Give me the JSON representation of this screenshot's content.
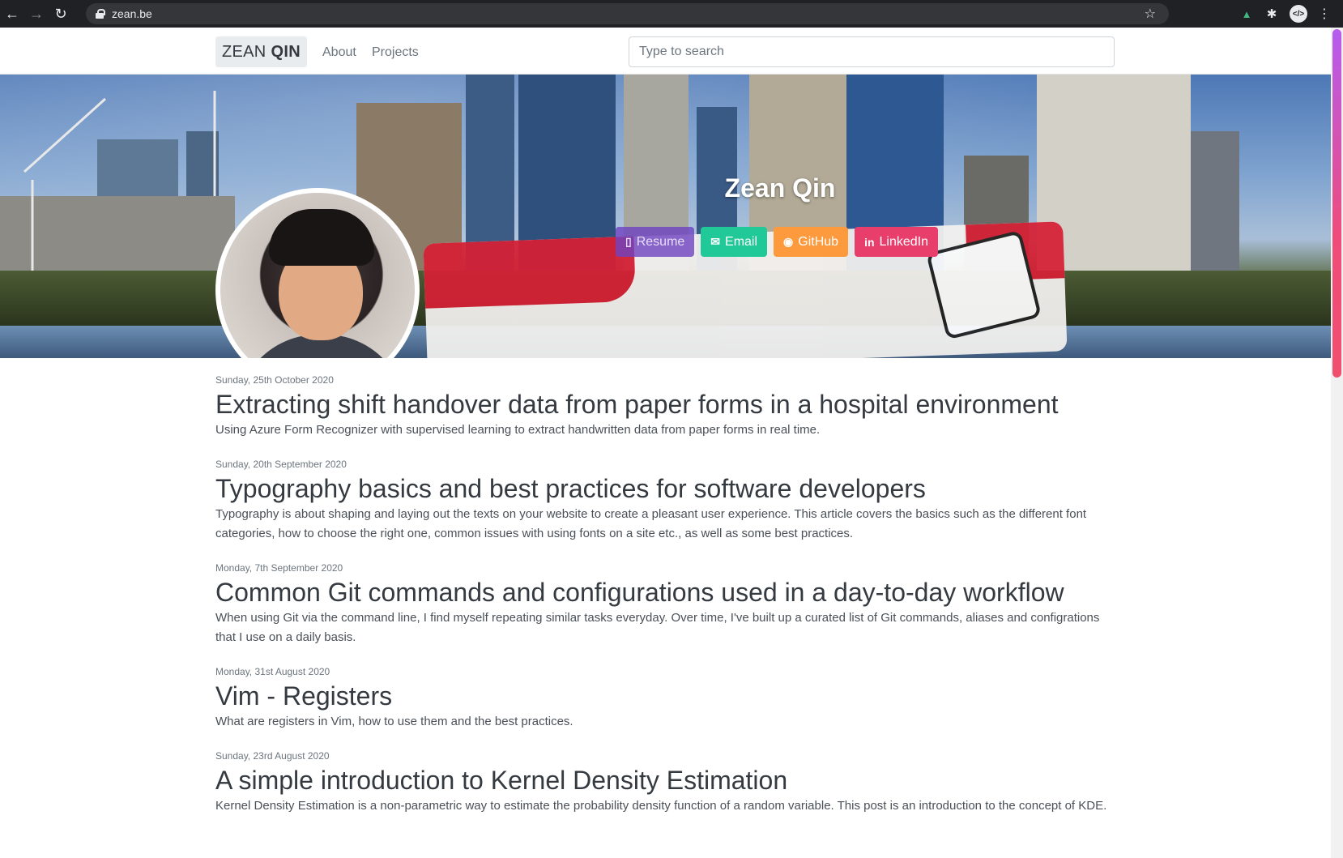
{
  "browser": {
    "url": "zean.be",
    "back_glyph": "←",
    "forward_glyph": "→",
    "reload_glyph": "↻",
    "star_glyph": "☆",
    "menu_glyph": "⋮",
    "dev_glyph": "</>",
    "vue_glyph": "▲",
    "ext_glyph": "✱"
  },
  "site": {
    "brand_first": "ZEAN",
    "brand_last": "QIN",
    "nav": {
      "about": "About",
      "projects": "Projects"
    },
    "search_placeholder": "Type to search"
  },
  "hero": {
    "name": "Zean Qin",
    "buttons": {
      "resume": {
        "label": "Resume",
        "icon": "file-icon",
        "glyph": "▯",
        "color": "#6f42c1"
      },
      "email": {
        "label": "Email",
        "icon": "envelope-icon",
        "glyph": "✉",
        "color": "#20c997"
      },
      "github": {
        "label": "GitHub",
        "icon": "github-icon",
        "glyph": "◉",
        "color": "#fd9a3e"
      },
      "linkedin": {
        "label": "LinkedIn",
        "icon": "linkedin-icon",
        "glyph": "in",
        "color": "#e83e6c"
      }
    }
  },
  "posts": [
    {
      "date": "Sunday, 25th October 2020",
      "title": "Extracting shift handover data from paper forms in a hospital environment",
      "excerpt": "Using Azure Form Recognizer with supervised learning to extract handwritten data from paper forms in real time."
    },
    {
      "date": "Sunday, 20th September 2020",
      "title": "Typography basics and best practices for software developers",
      "excerpt": "Typography is about shaping and laying out the texts on your website to create a pleasant user experience. This article covers the basics such as the different font categories, how to choose the right one, common issues with using fonts on a site etc., as well as some best practices."
    },
    {
      "date": "Monday, 7th September 2020",
      "title": "Common Git commands and configurations used in a day-to-day workflow",
      "excerpt": "When using Git via the command line, I find myself repeating similar tasks everyday. Over time, I've built up a curated list of Git commands, aliases and configrations that I use on a daily basis."
    },
    {
      "date": "Monday, 31st August 2020",
      "title": "Vim - Registers",
      "excerpt": "What are registers in Vim, how to use them and the best practices."
    },
    {
      "date": "Sunday, 23rd August 2020",
      "title": "A simple introduction to Kernel Density Estimation",
      "excerpt": "Kernel Density Estimation is a non-parametric way to estimate the probability density function of a random variable. This post is an introduction to the concept of KDE."
    }
  ]
}
